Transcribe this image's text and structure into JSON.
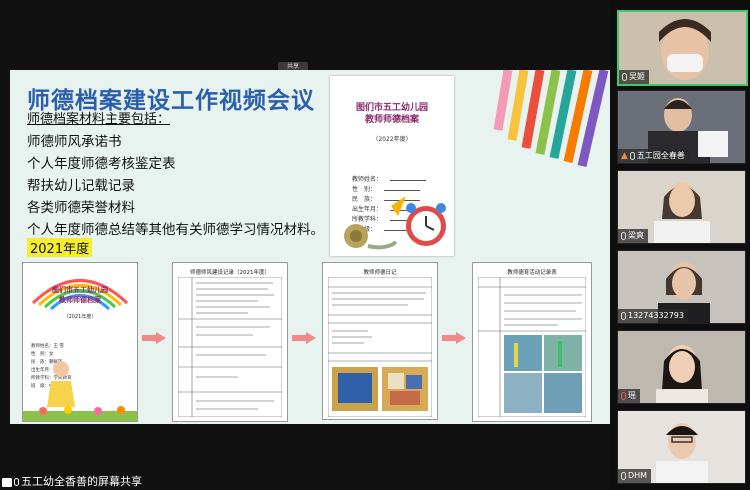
{
  "app": {
    "screen_share_label": "五工幼全香善的屏幕共享",
    "share_toolbar_text": "共享"
  },
  "slide": {
    "title": "师德档案建设工作视频会议",
    "intro": "师德档案材料主要包括：",
    "items": [
      "师德师风承诺书",
      "个人年度师德考核鉴定表",
      "帮扶幼儿记载记录",
      "各类师德荣誉材料",
      "个人年度师德总结等其他有关师德学习情况材料。"
    ],
    "year_label": "2021年度",
    "cover": {
      "title_line1": "图们市五工幼儿园",
      "title_line2": "教师师德档案",
      "year": "（2022年度）",
      "fields": [
        "教师姓名：",
        "性　别：",
        "民　族：",
        "出生年月：",
        "所教学科：",
        "班　级："
      ]
    },
    "flow": [
      {
        "title_line1": "图们市五工幼儿园",
        "title_line2": "教师师德档案",
        "year": "（2021年度）",
        "fields": [
          "教师姓名：王 雪",
          "性　别：女",
          "民　族：朝鲜族",
          "出生年月：",
          "所教学科：学前教育",
          "班　级：中班(1)班"
        ]
      },
      {
        "title": "师德师风建设记录（2021年度）"
      },
      {
        "title": "教师师德日记",
        "subtitle": "提示: 教师",
        "section": "活动照片"
      },
      {
        "title": "教师德育活动记录表",
        "row_labels": [
          "活动主题",
          "活动照片"
        ]
      }
    ]
  },
  "participants": [
    {
      "name": "吴姬",
      "mic": "on",
      "active": true
    },
    {
      "name": "五工园全春善",
      "mic": "on",
      "active": false
    },
    {
      "name": "梁爽",
      "mic": "on",
      "active": false
    },
    {
      "name": "13274332793",
      "mic": "on",
      "active": false
    },
    {
      "name": "瑶",
      "mic": "muted",
      "active": false
    },
    {
      "name": "DHM",
      "mic": "on",
      "active": false
    }
  ],
  "colors": {
    "slide_title": "#2b5fae",
    "highlight": "#f6ee2c",
    "active_border": "#3fc96b"
  }
}
